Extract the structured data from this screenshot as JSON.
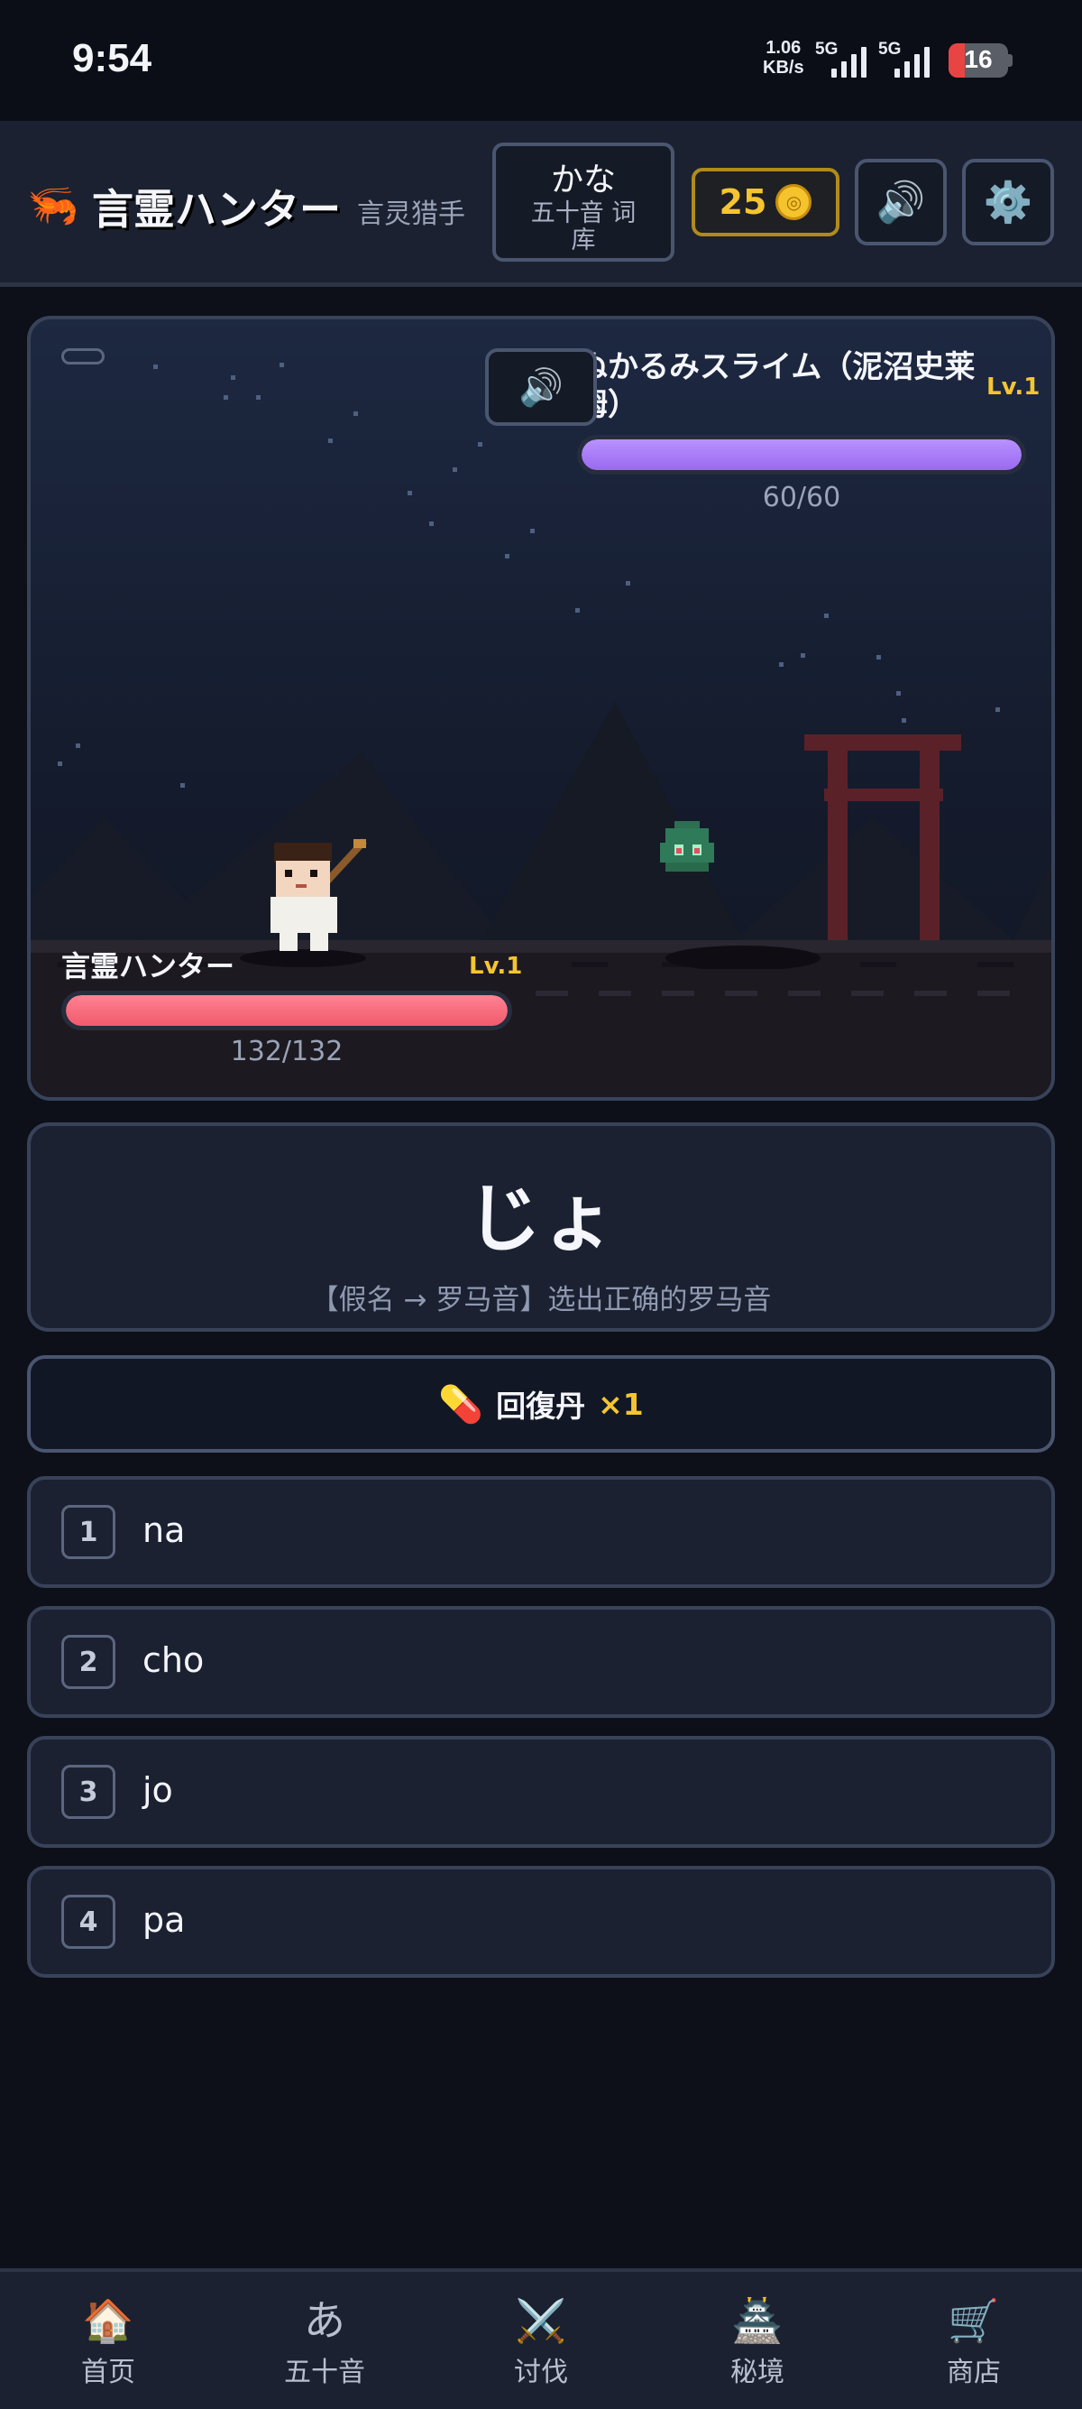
{
  "status": {
    "time": "9:54",
    "net_speed_value": "1.06",
    "net_speed_unit": "KB/s",
    "sim1": "5G",
    "sim2": "5G",
    "battery": "16"
  },
  "header": {
    "logo_icon": "shrimp-icon",
    "title": "言霊ハンター",
    "subtitle": "言灵猎手",
    "mode_main": "かな",
    "mode_sub": "五十音 词库",
    "coins": "25",
    "sound_icon": "speaker-icon",
    "settings_icon": "gear-icon"
  },
  "battle": {
    "enemy": {
      "name": "ぬかるみスライム（泥沼史莱姆）",
      "level": "Lv.1",
      "hp_text": "60/60",
      "hp_ratio": 1.0
    },
    "player": {
      "name": "言霊ハンター",
      "level": "Lv.1",
      "hp_text": "132/132",
      "hp_ratio": 1.0
    }
  },
  "question": {
    "kana": "じょ",
    "hint": "【假名 → 罗马音】选出正确的罗马音"
  },
  "potion": {
    "icon": "pill-icon",
    "label": "回復丹",
    "count": "×1"
  },
  "options": [
    {
      "num": "1",
      "text": "na"
    },
    {
      "num": "2",
      "text": "cho"
    },
    {
      "num": "3",
      "text": "jo"
    },
    {
      "num": "4",
      "text": "pa"
    }
  ],
  "tabs": [
    {
      "icon": "🏠",
      "label": "首页"
    },
    {
      "icon": "あ",
      "label": "五十音"
    },
    {
      "icon": "⚔️",
      "label": "讨伐"
    },
    {
      "icon": "🏯",
      "label": "秘境"
    },
    {
      "icon": "🛒",
      "label": "商店"
    }
  ],
  "colors": {
    "accent_gold": "#f4c531",
    "enemy_hp": "#a97cff",
    "player_hp": "#f56b7c",
    "background": "#0d1019"
  }
}
